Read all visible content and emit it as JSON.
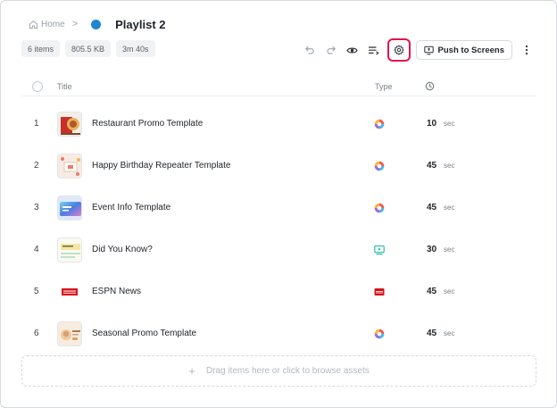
{
  "breadcrumb": {
    "home_label": "Home",
    "separator": ">"
  },
  "playlist": {
    "title": "Playlist 2",
    "color": "#1f86d3"
  },
  "stats": {
    "items": "6 items",
    "size": "805.5 KB",
    "duration": "3m 40s"
  },
  "toolbar": {
    "icons": [
      "undo-icon",
      "redo-icon",
      "eye-icon",
      "queue-icon",
      "gear-icon",
      "more-vertical-icon"
    ],
    "push_label": "Push to Screens",
    "highlight_color": "#e0154c"
  },
  "table": {
    "headers": {
      "title": "Title",
      "type": "Type",
      "duration_icon": "clock-icon"
    },
    "rows": [
      {
        "num": "1",
        "title": "Restaurant Promo Template",
        "duration": "10",
        "unit": "sec",
        "type_icon": "app-icon"
      },
      {
        "num": "2",
        "title": "Happy Birthday Repeater Template",
        "duration": "45",
        "unit": "sec",
        "type_icon": "app-icon"
      },
      {
        "num": "3",
        "title": "Event Info Template",
        "duration": "45",
        "unit": "sec",
        "type_icon": "app-icon"
      },
      {
        "num": "4",
        "title": "Did You Know?",
        "duration": "30",
        "unit": "sec",
        "type_icon": "media-icon"
      },
      {
        "num": "5",
        "title": "ESPN News",
        "duration": "45",
        "unit": "sec",
        "type_icon": "espn-icon"
      },
      {
        "num": "6",
        "title": "Seasonal Promo Template",
        "duration": "45",
        "unit": "sec",
        "type_icon": "app-icon"
      }
    ]
  },
  "dropzone": {
    "label": "Drag items here or click to browse assets"
  }
}
